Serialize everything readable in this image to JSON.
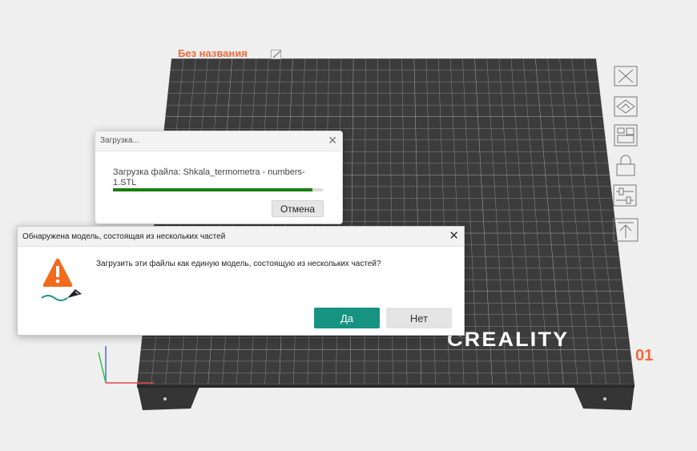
{
  "project": {
    "title": "Без названия"
  },
  "plate": {
    "brand": "CREALITY",
    "number": "01"
  },
  "toolbar": {
    "items": [
      {
        "name": "close-tool",
        "icon": "close-x-icon"
      },
      {
        "name": "auto-orient-tool",
        "icon": "orient-icon"
      },
      {
        "name": "arrange-tool",
        "icon": "arrange-icon"
      },
      {
        "name": "lock-tool",
        "icon": "lock-icon"
      },
      {
        "name": "settings-tool",
        "icon": "sliders-icon"
      },
      {
        "name": "lay-on-face-tool",
        "icon": "upload-arrow-icon"
      }
    ]
  },
  "loading_dialog": {
    "title": "Загрузка...",
    "message": "Загрузка файла: Shkala_termometra - numbers-1.STL",
    "progress": 0.95,
    "cancel_label": "Отмена"
  },
  "multipart_dialog": {
    "title": "Обнаружена модель, состоящая из нескольких частей",
    "question": "Загрузить эти файлы как единую модель, состоящую из нескольких частей?",
    "yes_label": "Да",
    "no_label": "Нет"
  },
  "colors": {
    "background": "#efefef",
    "bed": "#3a3a3a",
    "accent_orange": "#f06a3c",
    "primary_button": "#179382",
    "progress": "#18800e"
  }
}
